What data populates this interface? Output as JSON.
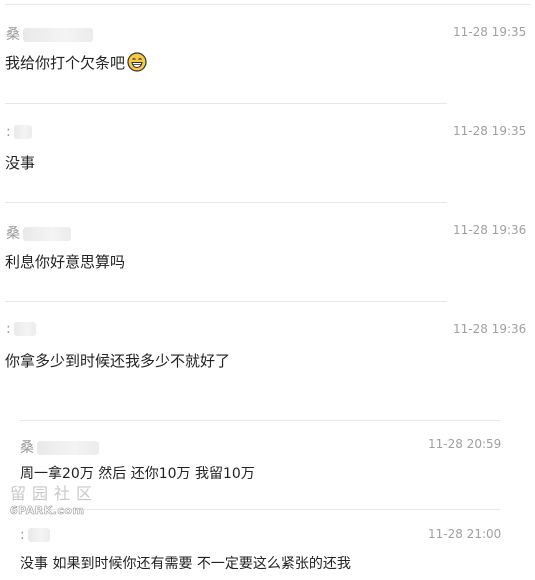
{
  "messages": [
    {
      "sender": "桑",
      "time": "11-28 19:35",
      "text": "我给你打个欠条吧",
      "emoji": "grinning-emoji-icon"
    },
    {
      "sender": ":",
      "time": "11-28 19:35",
      "text": "没事"
    },
    {
      "sender": "桑",
      "time": "11-28 19:36",
      "text": "利息你好意思算吗"
    },
    {
      "sender": ":",
      "time": "11-28 19:36",
      "text": "你拿多少到时候还我多少不就好了"
    },
    {
      "sender": "桑",
      "time": "11-28 20:59",
      "text": "周一拿20万 然后 还你10万 我留10万"
    },
    {
      "sender": ":",
      "time": "11-28 21:00",
      "text": "没事 如果到时候你还有需要 不一定要这么紧张的还我"
    }
  ],
  "watermark": {
    "glyphs": "留园社区",
    "url": "6PARK.com"
  },
  "colors": {
    "divider": "#e8e8e8",
    "sender": "#9a9a9a",
    "time": "#a0a0a0",
    "text": "#222222",
    "emoji_face": "#f7c948"
  }
}
